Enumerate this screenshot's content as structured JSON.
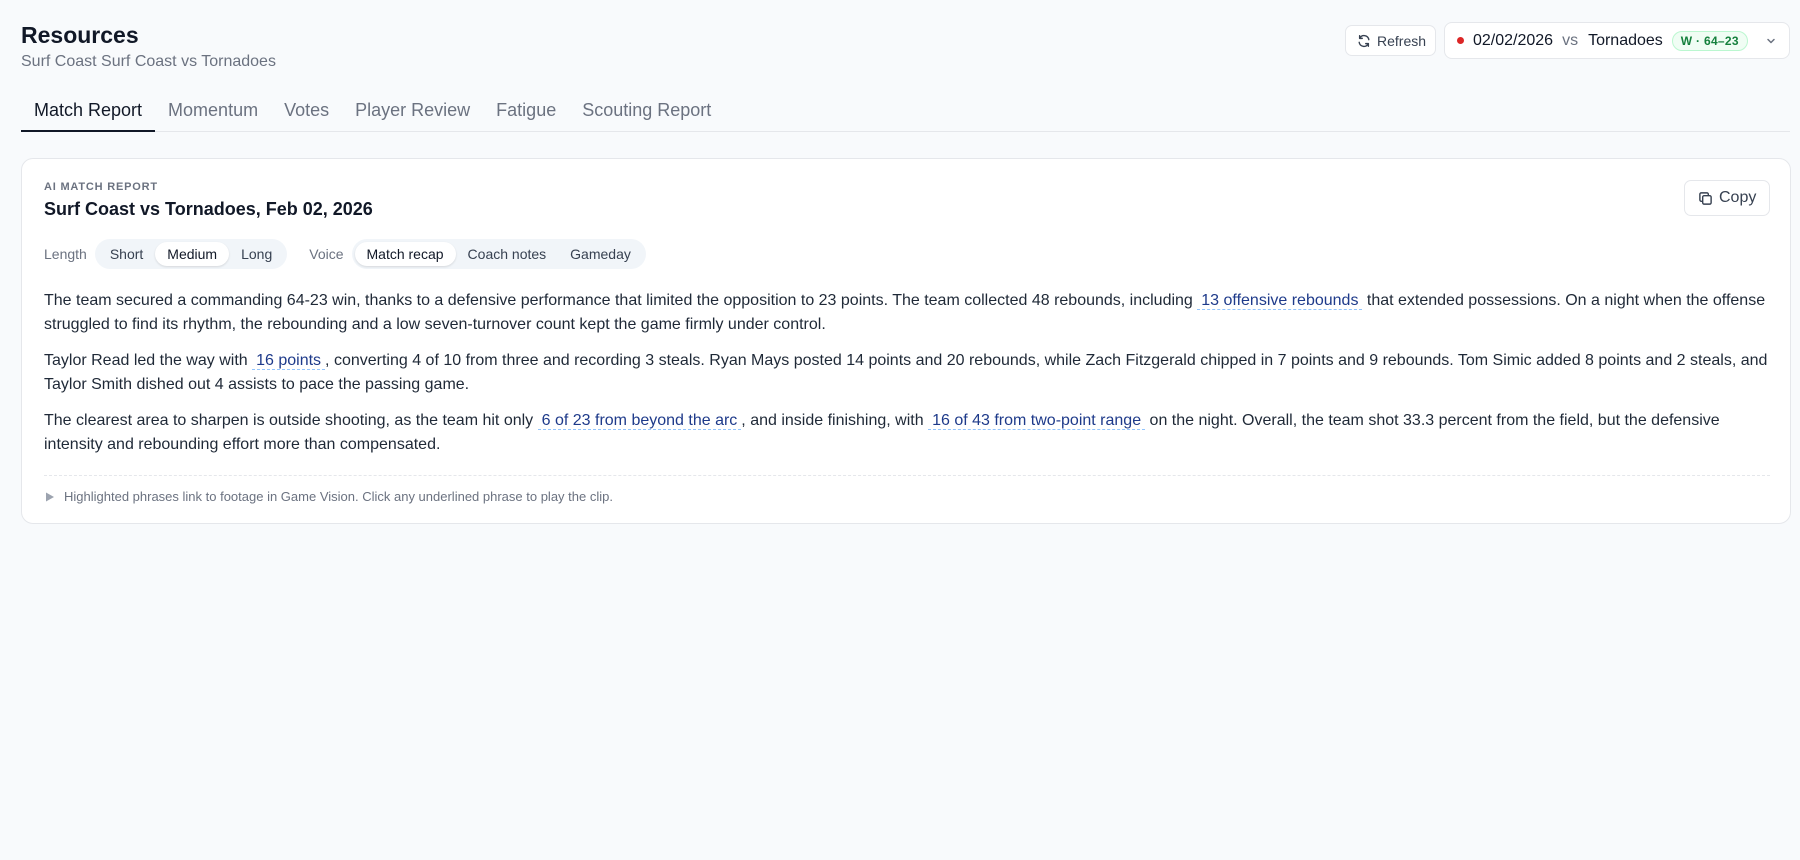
{
  "header": {
    "title": "Resources",
    "subtitle": "Surf Coast Surf Coast vs Tornadoes",
    "refresh_label": "Refresh",
    "game_select": {
      "date": "02/02/2026",
      "vs": "vs",
      "opponent": "Tornadoes",
      "result": "W · 64–23"
    }
  },
  "tabs": [
    {
      "label": "Match Report",
      "active": true
    },
    {
      "label": "Momentum"
    },
    {
      "label": "Votes"
    },
    {
      "label": "Player Review"
    },
    {
      "label": "Fatigue"
    },
    {
      "label": "Scouting Report"
    }
  ],
  "card": {
    "eyebrow": "AI MATCH REPORT",
    "title": "Surf Coast vs Tornadoes, Feb 02, 2026",
    "copy_label": "Copy",
    "length": {
      "label": "Length",
      "options": [
        "Short",
        "Medium",
        "Long"
      ],
      "selected": "Medium"
    },
    "voice": {
      "label": "Voice",
      "options": [
        "Match recap",
        "Coach notes",
        "Gameday"
      ],
      "selected": "Match recap"
    },
    "paragraphs": [
      {
        "before": "The team secured a commanding 64-23 win, thanks to a defensive performance that limited the opposition to 23 points. The team collected 48 rebounds, including ",
        "link": "13 offensive rebounds",
        "after": " that extended possessions. On a night when the offense struggled to find its rhythm, the rebounding and a low seven-turnover count kept the game firmly under control."
      },
      {
        "before": "Taylor Read led the way with ",
        "link": "16 points",
        "after": ", converting 4 of 10 from three and recording 3 steals. Ryan Mays posted 14 points and 20 rebounds, while Zach Fitzgerald chipped in 7 points and 9 rebounds. Tom Simic added 8 points and 2 steals, and Taylor Smith dished out 4 assists to pace the passing game."
      },
      {
        "before": "The clearest area to sharpen is outside shooting, as the team hit only ",
        "link": "6 of 23 from beyond the arc",
        "middle": ", and inside finishing, with ",
        "link2": "16 of 43 from two-point range",
        "after": " on the night. Overall, the team shot 33.3 percent from the field, but the defensive intensity and rebounding effort more than compensated."
      }
    ],
    "footnote": "Highlighted phrases link to footage in Game Vision. Click any underlined phrase to play the clip."
  },
  "colors": {
    "background": "#f8fafc",
    "link": "#1e3a8a",
    "win_badge": "#15803d",
    "live_dot": "#dc2626"
  },
  "icons": [
    "refresh-icon",
    "chevron-down-icon",
    "copy-icon",
    "play-icon"
  ]
}
